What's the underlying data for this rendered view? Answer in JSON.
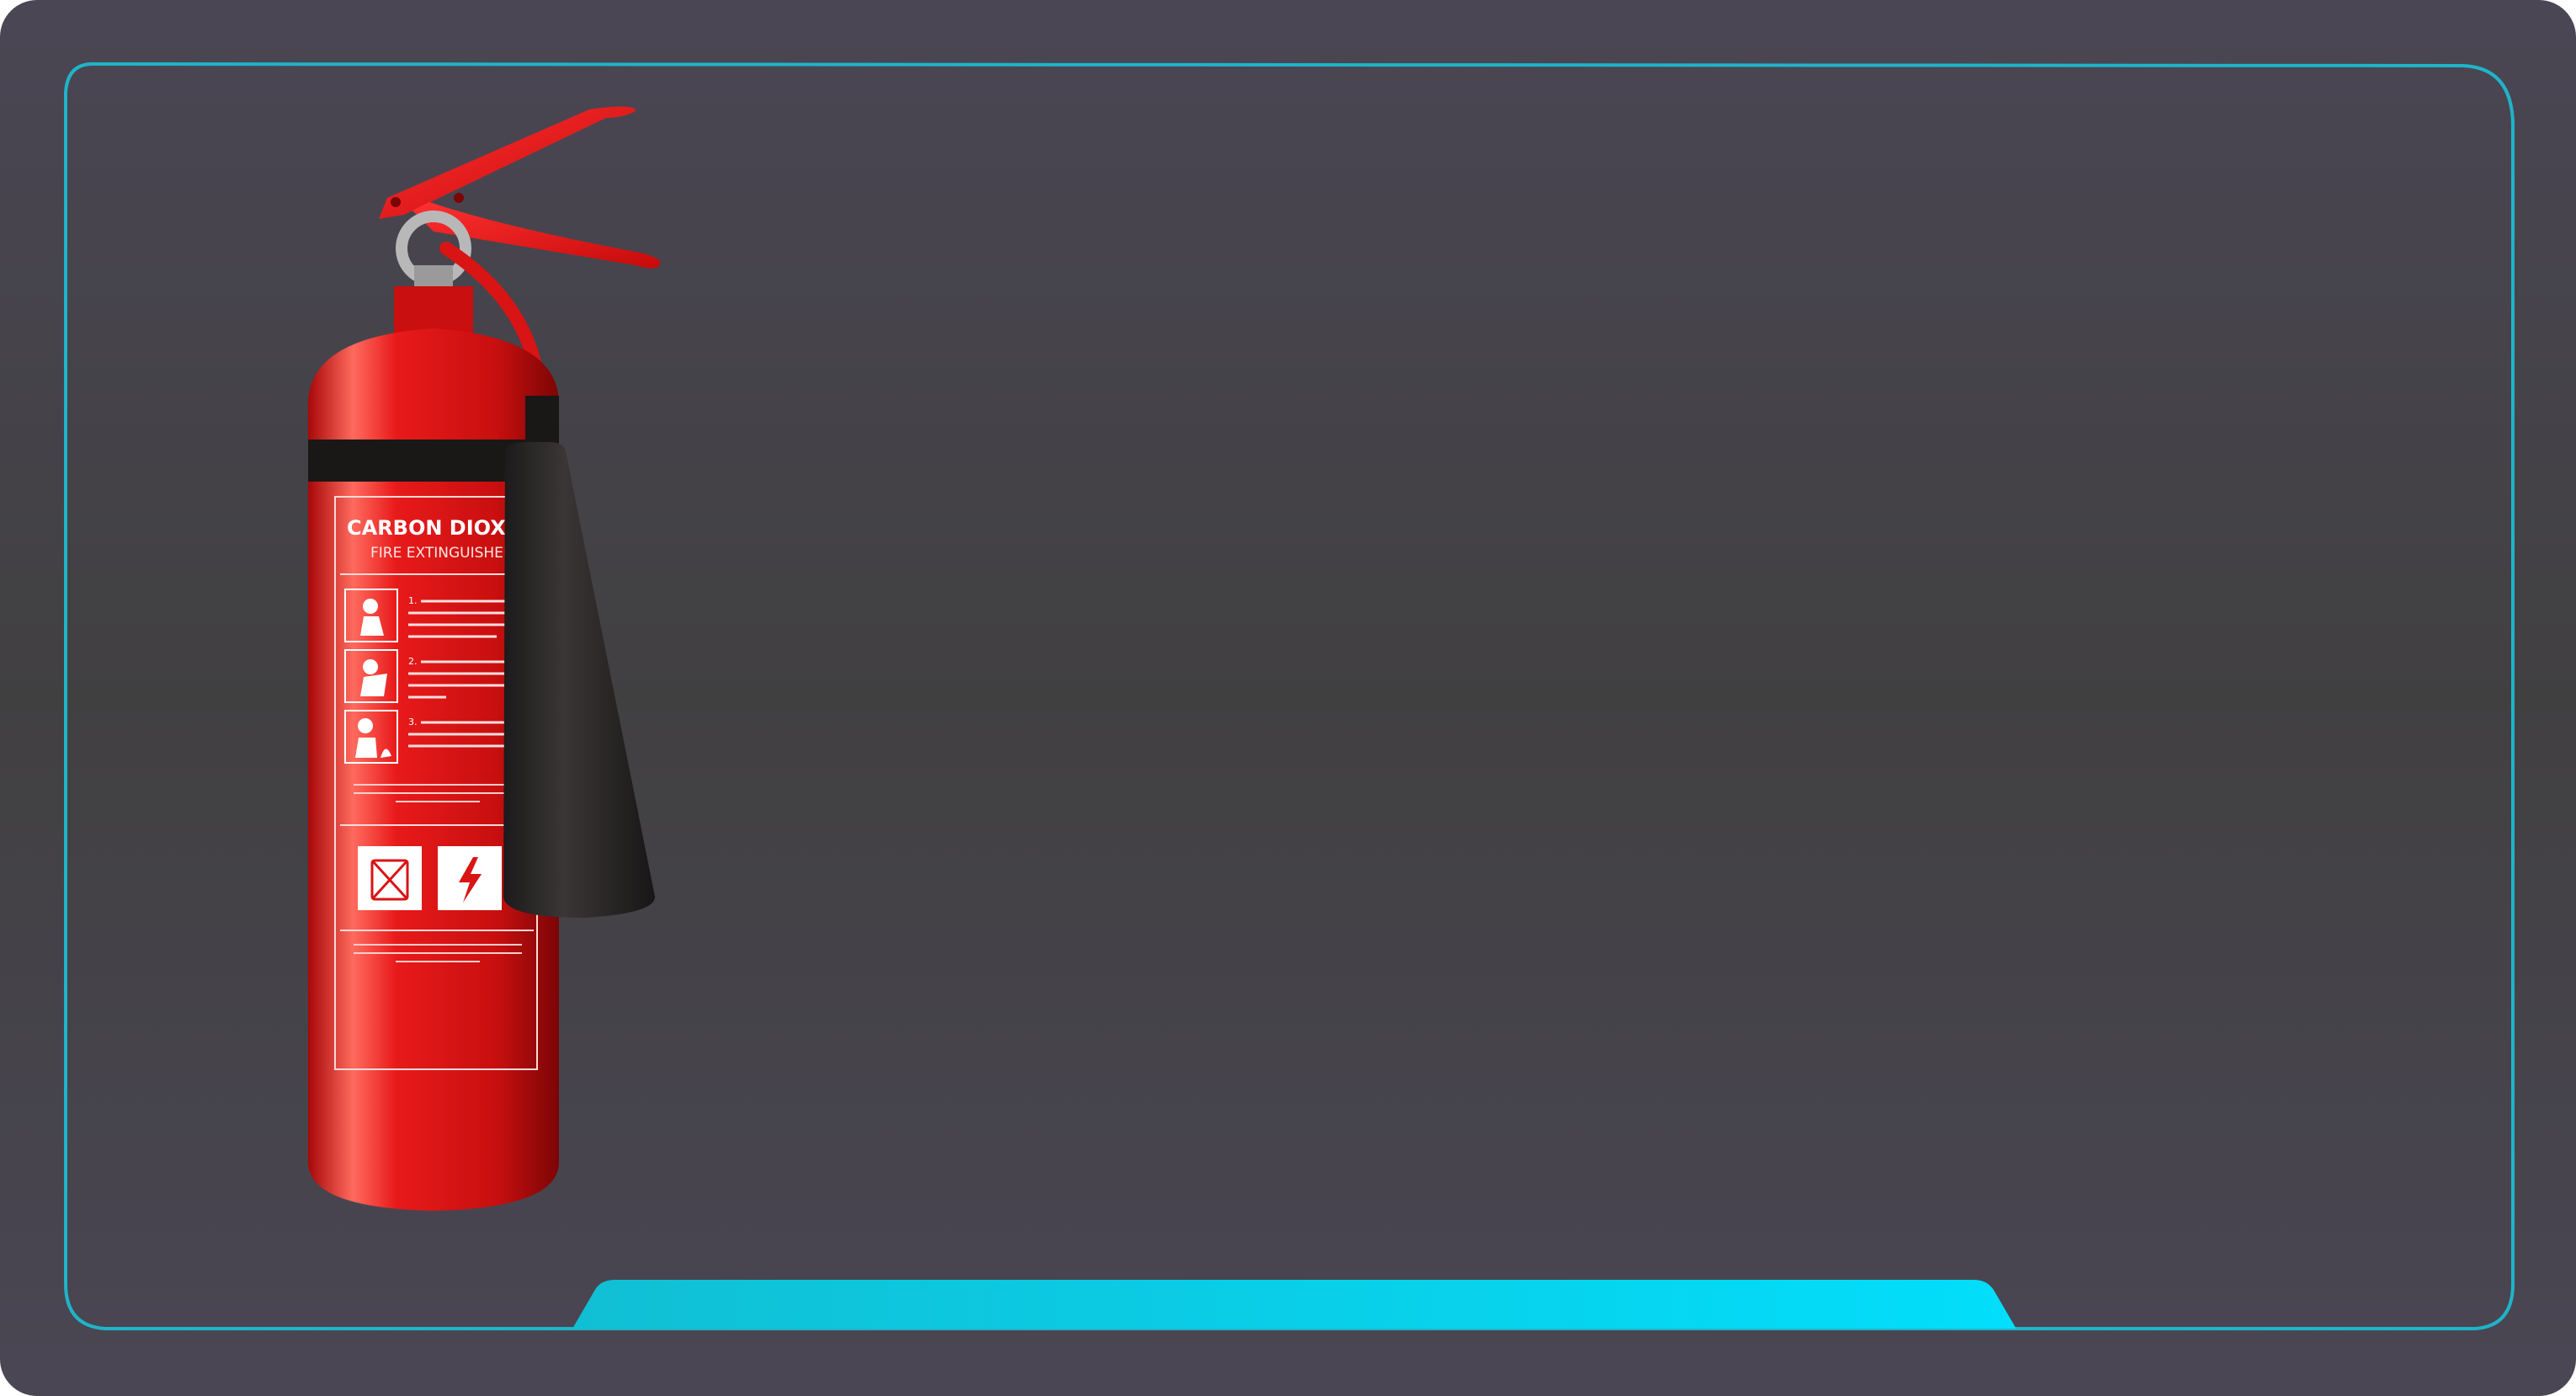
{
  "slide": {
    "background_color": "#434146",
    "frame_color": "#1fb4c8",
    "accent_bar_color": "#06d8f7"
  },
  "extinguisher": {
    "label_title": "CARBON DIOXID",
    "label_subtitle": "FIRE EXTINGUISHER",
    "instructions": [
      {
        "number": "1.",
        "icon": "pull-pin-pictogram-icon"
      },
      {
        "number": "2.",
        "icon": "aim-hose-pictogram-icon"
      },
      {
        "number": "3.",
        "icon": "squeeze-spray-pictogram-icon"
      }
    ],
    "hazard_icons": [
      "no-liquid-fire-icon",
      "electrical-hazard-icon"
    ],
    "body_color": "#d81414",
    "horn_color": "#2a2727"
  }
}
